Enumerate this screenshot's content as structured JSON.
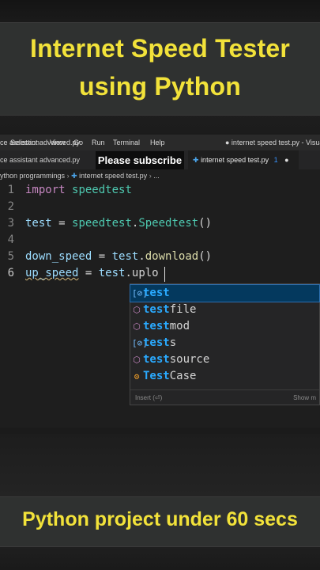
{
  "title": {
    "line1": "Internet Speed Tester",
    "line2": "using Python"
  },
  "menubar": {
    "items": [
      "ce assistant advanced.py",
      "Selection",
      "View",
      "Go",
      "Run",
      "Terminal",
      "Help"
    ],
    "window_title": "● internet speed test.py - Visual"
  },
  "tabs": {
    "left_tab": "ce assistant advanced.py",
    "overlay_label": "Please subscribe",
    "active_tab": "internet speed test.py",
    "active_badge": "1",
    "modified_dot": "●"
  },
  "breadcrumb": {
    "folder": "ython programmings",
    "file": "internet speed test.py",
    "more": "..."
  },
  "editor": {
    "lines": [
      {
        "n": "1",
        "tokens": [
          [
            "kw",
            "import"
          ],
          [
            "plain",
            " "
          ],
          [
            "mod",
            "speedtest"
          ]
        ]
      },
      {
        "n": "2",
        "tokens": []
      },
      {
        "n": "3",
        "tokens": [
          [
            "var",
            "test"
          ],
          [
            "plain",
            " = "
          ],
          [
            "mod",
            "speedtest"
          ],
          [
            "plain",
            "."
          ],
          [
            "mod",
            "Speedtest"
          ],
          [
            "plain",
            "()"
          ]
        ]
      },
      {
        "n": "4",
        "tokens": []
      },
      {
        "n": "5",
        "tokens": [
          [
            "var",
            "down_speed"
          ],
          [
            "plain",
            " = "
          ],
          [
            "var",
            "test"
          ],
          [
            "plain",
            "."
          ],
          [
            "fn",
            "download"
          ],
          [
            "plain",
            "()"
          ]
        ]
      },
      {
        "n": "6",
        "tokens": [
          [
            "var",
            "up_speed"
          ],
          [
            "plain",
            " = "
          ],
          [
            "var",
            "test"
          ],
          [
            "plain",
            "."
          ],
          [
            "plain",
            "uplo"
          ]
        ]
      }
    ]
  },
  "suggestions": {
    "items": [
      {
        "icon": "[⊘]",
        "match": "test",
        "rest": "",
        "kind": "variable"
      },
      {
        "icon": "⬡",
        "match": "test",
        "rest": "file",
        "kind": "module"
      },
      {
        "icon": "⬡",
        "match": "test",
        "rest": "mod",
        "kind": "module"
      },
      {
        "icon": "[⊘]",
        "match": "test",
        "rest": "s",
        "kind": "variable"
      },
      {
        "icon": "⬡",
        "match": "test",
        "rest": "source",
        "kind": "module"
      },
      {
        "icon": "⚙",
        "match": "Test",
        "rest": "Case",
        "kind": "class"
      }
    ],
    "footer_left": "Insert (⏎)",
    "footer_right": "Show m"
  },
  "footer": {
    "text": "Python project under 60 secs"
  },
  "colors": {
    "title": "#f2e23a",
    "editor_bg": "#1e1e1e",
    "highlight": "#2aaaff"
  }
}
